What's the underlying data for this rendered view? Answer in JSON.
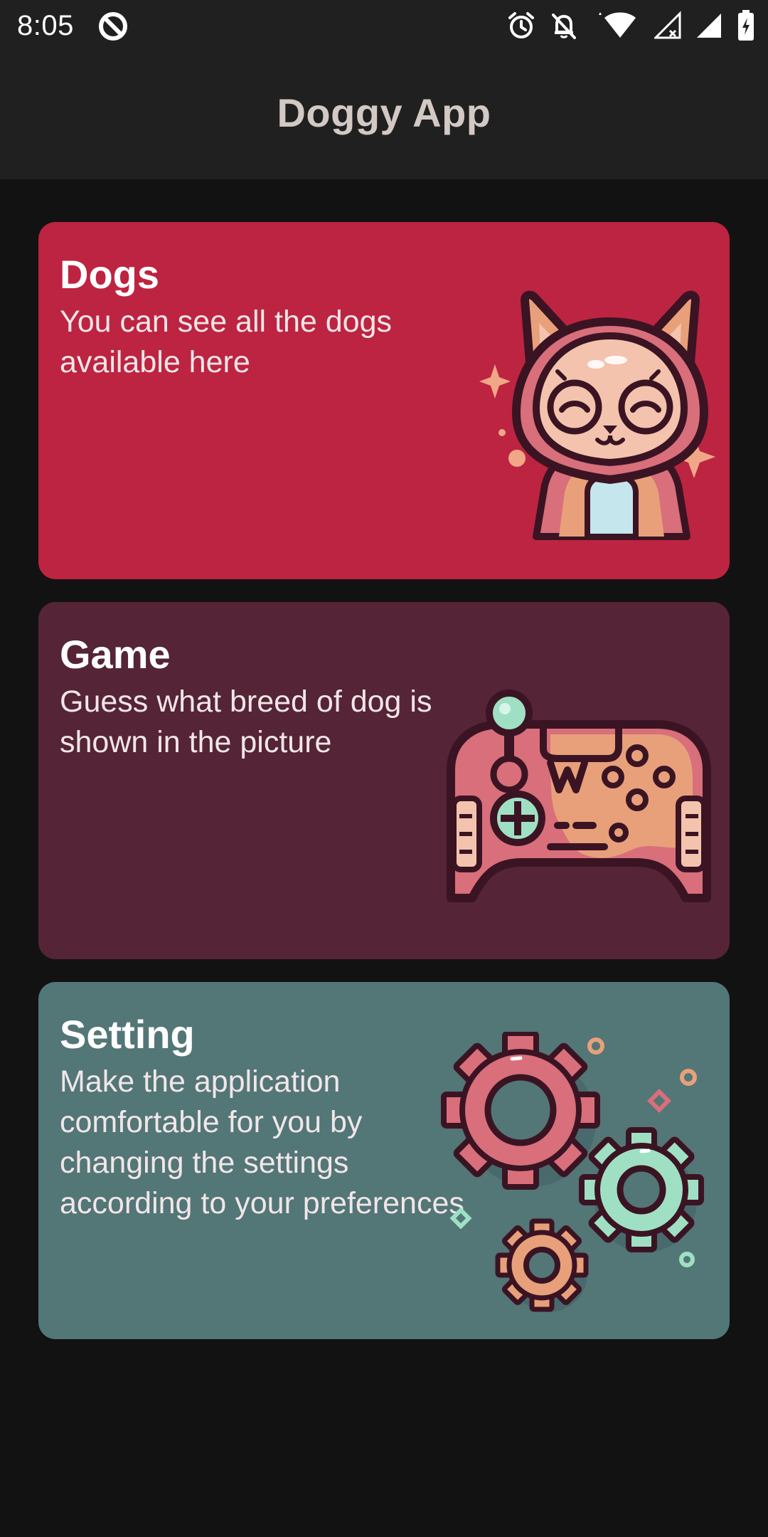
{
  "status_bar": {
    "time": "8:05",
    "icons": [
      "data-saver-icon",
      "alarm-icon",
      "notifications-off-icon",
      "wifi-icon",
      "signal-icon",
      "signal-icon",
      "battery-icon"
    ]
  },
  "app_bar": {
    "title": "Doggy App"
  },
  "cards": [
    {
      "title": "Dogs",
      "description": "You can see all the dogs available here",
      "icon": "dog-icon",
      "color": "#bd2441"
    },
    {
      "title": "Game",
      "description": "Guess what breed of dog is shown in the picture",
      "icon": "gamepad-icon",
      "color": "#552436"
    },
    {
      "title": "Setting",
      "description": "Make the application comfortable for you by changing the settings according to your preferences",
      "icon": "gears-icon",
      "color": "#537677"
    }
  ],
  "colors": {
    "background": "#121212",
    "app_bar": "#202020",
    "title_text": "#d2c9c4"
  }
}
